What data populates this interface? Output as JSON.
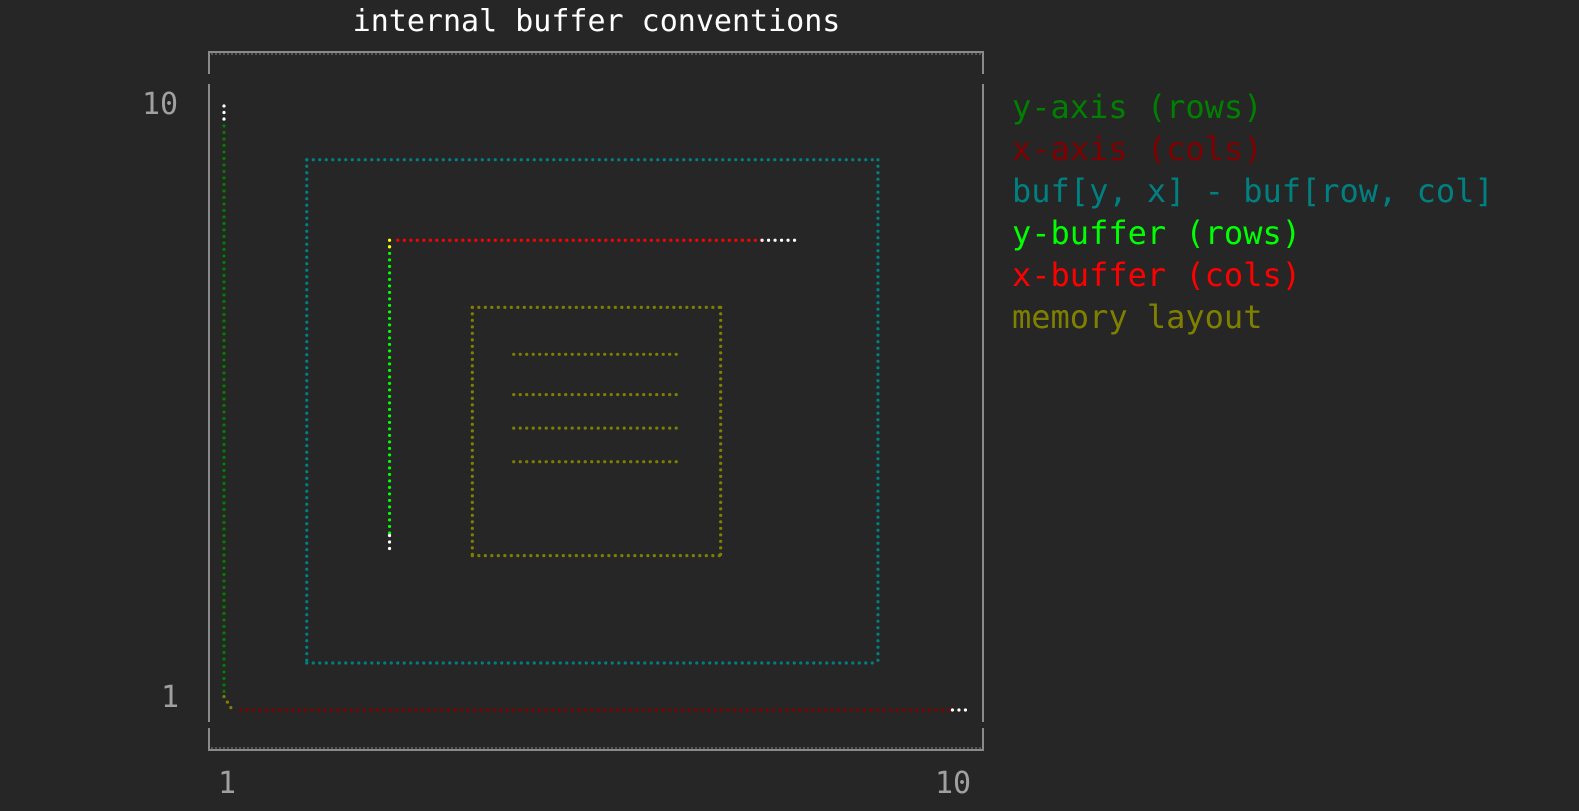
{
  "chart_data": {
    "type": "scatter",
    "title": "internal buffer conventions",
    "xlabel": "",
    "ylabel": "",
    "xlim": [
      1,
      10
    ],
    "ylim": [
      1,
      10
    ],
    "xticks": [
      "1",
      "10"
    ],
    "yticks": [
      "1",
      "10"
    ],
    "grid": false,
    "legend_placement": "outside-right",
    "series": [
      {
        "name": "y-axis (rows)",
        "color": "#008000",
        "segments": [
          {
            "from": [
              1.0,
              9.8
            ],
            "to": [
              1.0,
              1.2
            ]
          }
        ]
      },
      {
        "name": "x-axis (cols)",
        "color": "#800000",
        "segments": [
          {
            "from": [
              1.2,
              1.0
            ],
            "to": [
              9.8,
              1.0
            ]
          }
        ]
      },
      {
        "name": "buf[y, x] - buf[row, col]",
        "color": "#008080",
        "segments": [
          {
            "from": [
              2.0,
              9.2
            ],
            "to": [
              8.9,
              9.2
            ]
          },
          {
            "from": [
              2.0,
              1.7
            ],
            "to": [
              8.9,
              1.7
            ]
          },
          {
            "from": [
              2.0,
              9.2
            ],
            "to": [
              2.0,
              1.7
            ]
          },
          {
            "from": [
              8.9,
              9.2
            ],
            "to": [
              8.9,
              1.7
            ]
          }
        ]
      },
      {
        "name": "y-buffer (rows)",
        "color": "#00ff00",
        "segments": [
          {
            "from": [
              3.0,
              7.9
            ],
            "to": [
              3.0,
              3.6
            ]
          }
        ]
      },
      {
        "name": "x-buffer (cols)",
        "color": "#ff0000",
        "segments": [
          {
            "from": [
              3.1,
              8.0
            ],
            "to": [
              7.5,
              8.0
            ]
          }
        ]
      },
      {
        "name": "memory layout",
        "color": "#808000",
        "segments": [
          {
            "from": [
              4.0,
              7.0
            ],
            "to": [
              7.0,
              7.0
            ]
          },
          {
            "from": [
              4.0,
              3.3
            ],
            "to": [
              7.0,
              3.3
            ]
          },
          {
            "from": [
              4.0,
              7.0
            ],
            "to": [
              4.0,
              3.3
            ]
          },
          {
            "from": [
              7.0,
              7.0
            ],
            "to": [
              7.0,
              3.3
            ]
          },
          {
            "from": [
              4.5,
              6.3
            ],
            "to": [
              6.5,
              6.3
            ]
          },
          {
            "from": [
              4.5,
              5.7
            ],
            "to": [
              6.5,
              5.7
            ]
          },
          {
            "from": [
              4.5,
              5.2
            ],
            "to": [
              6.5,
              5.2
            ]
          },
          {
            "from": [
              4.5,
              4.7
            ],
            "to": [
              6.5,
              4.7
            ]
          }
        ]
      }
    ],
    "markers": [
      {
        "color": "#ffffff",
        "from": [
          1.0,
          10.0
        ],
        "to": [
          1.0,
          9.8
        ]
      },
      {
        "color": "#ffffff",
        "from": [
          9.8,
          1.0
        ],
        "to": [
          10.0,
          1.0
        ]
      },
      {
        "color": "#ffffff",
        "from": [
          7.5,
          8.0
        ],
        "to": [
          7.9,
          8.0
        ]
      },
      {
        "color": "#ffffff",
        "from": [
          3.0,
          3.6
        ],
        "to": [
          3.0,
          3.4
        ]
      },
      {
        "color": "#ffff00",
        "from": [
          3.0,
          8.0
        ],
        "to": [
          3.0,
          7.9
        ]
      },
      {
        "color": "#808000",
        "from": [
          1.0,
          1.2
        ],
        "to": [
          1.1,
          1.0
        ]
      }
    ]
  }
}
